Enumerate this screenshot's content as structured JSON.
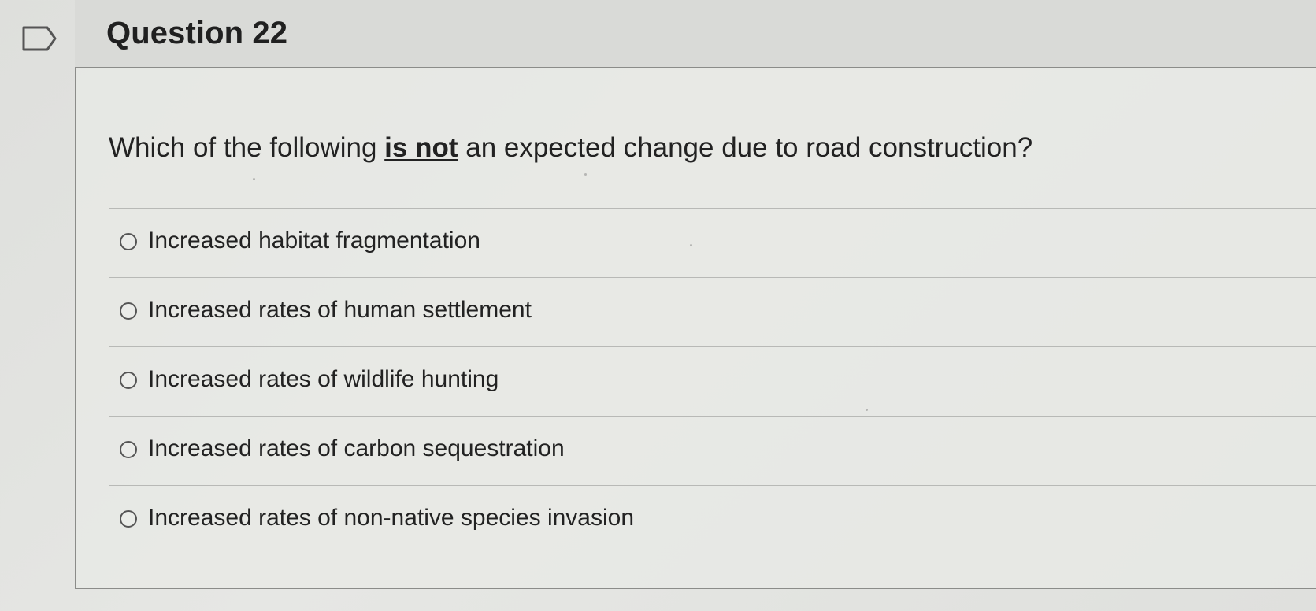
{
  "question": {
    "title": "Question 22",
    "prompt_before": "Which of the following ",
    "prompt_emphasis": "is not",
    "prompt_after": " an expected change due to road construction?"
  },
  "answers": [
    {
      "label": "Increased habitat fragmentation"
    },
    {
      "label": "Increased rates of human settlement"
    },
    {
      "label": "Increased rates of wildlife hunting"
    },
    {
      "label": "Increased rates of carbon sequestration"
    },
    {
      "label": "Increased rates of non-native species invasion"
    }
  ],
  "icons": {
    "flag": "flag-icon",
    "answer_radio": "radio-button-icon"
  },
  "colors": {
    "background": "#e6e7e4",
    "header_background": "#d9dad7",
    "border": "#8b8c89",
    "text": "#222222"
  }
}
